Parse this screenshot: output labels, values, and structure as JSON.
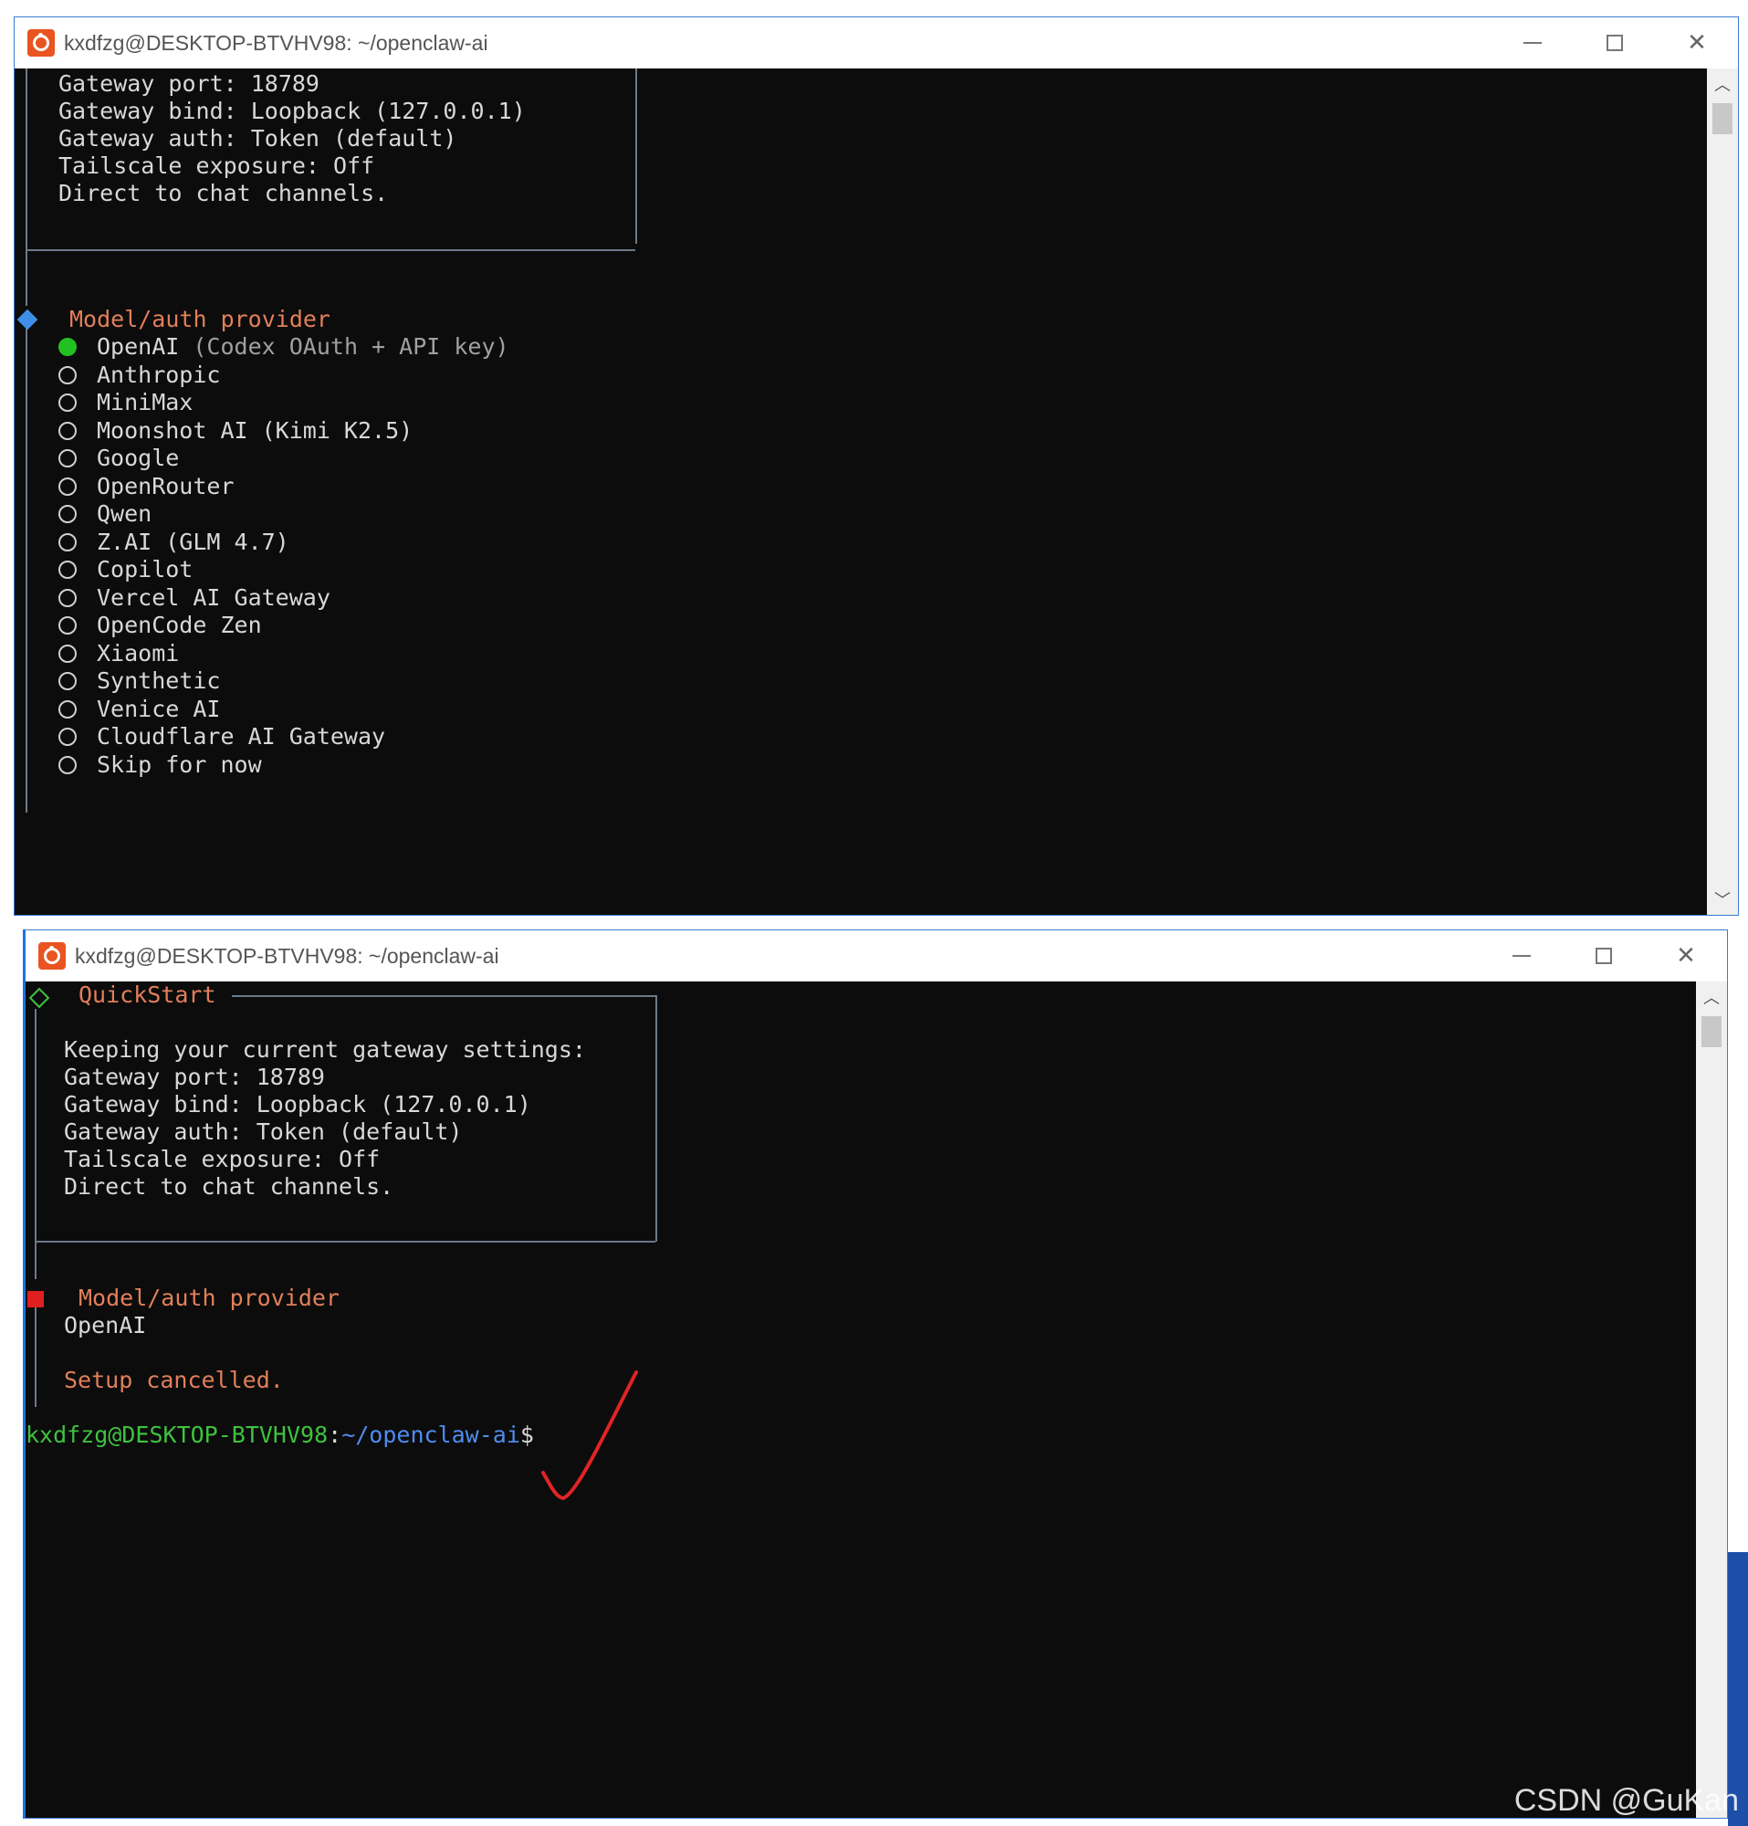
{
  "window1": {
    "title": "kxdfzg@DESKTOP-BTVHV98: ~/openclaw-ai",
    "controls": {
      "minimize": "minimize",
      "maximize": "maximize",
      "close": "✕"
    },
    "info_lines": [
      "Gateway port: 18789",
      "Gateway bind: Loopback (127.0.0.1)",
      "Gateway auth: Token (default)",
      "Tailscale exposure: Off",
      "Direct to chat channels."
    ],
    "prompt_label": "Model/auth provider",
    "options": [
      {
        "name": "OpenAI",
        "hint": "(Codex OAuth + API key)",
        "selected": true
      },
      {
        "name": "Anthropic",
        "hint": "",
        "selected": false
      },
      {
        "name": "MiniMax",
        "hint": "",
        "selected": false
      },
      {
        "name": "Moonshot AI (Kimi K2.5)",
        "hint": "",
        "selected": false
      },
      {
        "name": "Google",
        "hint": "",
        "selected": false
      },
      {
        "name": "OpenRouter",
        "hint": "",
        "selected": false
      },
      {
        "name": "Qwen",
        "hint": "",
        "selected": false
      },
      {
        "name": "Z.AI (GLM 4.7)",
        "hint": "",
        "selected": false
      },
      {
        "name": "Copilot",
        "hint": "",
        "selected": false
      },
      {
        "name": "Vercel AI Gateway",
        "hint": "",
        "selected": false
      },
      {
        "name": "OpenCode Zen",
        "hint": "",
        "selected": false
      },
      {
        "name": "Xiaomi",
        "hint": "",
        "selected": false
      },
      {
        "name": "Synthetic",
        "hint": "",
        "selected": false
      },
      {
        "name": "Venice AI",
        "hint": "",
        "selected": false
      },
      {
        "name": "Cloudflare AI Gateway",
        "hint": "",
        "selected": false
      },
      {
        "name": "Skip for now",
        "hint": "",
        "selected": false
      }
    ]
  },
  "window2": {
    "title": "kxdfzg@DESKTOP-BTVHV98: ~/openclaw-ai",
    "controls": {
      "minimize": "minimize",
      "maximize": "maximize",
      "close": "✕"
    },
    "box_title": "QuickStart",
    "info_lines": [
      "Keeping your current gateway settings:",
      "Gateway port: 18789",
      "Gateway bind: Loopback (127.0.0.1)",
      "Gateway auth: Token (default)",
      "Tailscale exposure: Off",
      "Direct to chat channels."
    ],
    "prompt_label": "Model/auth provider",
    "prompt_answer": "OpenAI",
    "status": "Setup cancelled.",
    "shell": {
      "user_host": "kxdfzg@DESKTOP-BTVHV98",
      "separator": ":",
      "path": "~/openclaw-ai",
      "symbol": "$"
    }
  },
  "watermark": "CSDN @GuKan",
  "colors": {
    "terminal_bg": "#0c0c0c",
    "prompt_orange": "#e27f5a",
    "selected_green": "#22c022",
    "accent_blue": "#3f8fe8",
    "cancel_red": "#e02020",
    "checkmark_red": "#e02424"
  }
}
